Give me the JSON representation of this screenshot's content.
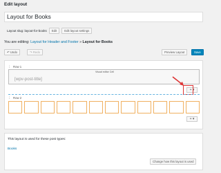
{
  "page": {
    "title": "Edit layout"
  },
  "layout": {
    "name": "Layout for Books",
    "slug_label": "Layout slug:",
    "slug": "layout-for-books",
    "edit_label": "Edit",
    "settings_label": "Edit layout settings"
  },
  "editing": {
    "prefix": "You are editing:",
    "parent": "Layout for Header and Footer",
    "separator": "»",
    "current": "Layout for Books"
  },
  "toolbar": {
    "undo_label": "↶ Undo",
    "redo_label": "↷ Redo",
    "preview_label": "Preview Layout",
    "save_label": "Save"
  },
  "rows": [
    {
      "label": "Row 1",
      "cell_caption": "Visual editor Cell",
      "cell_content": "[wpv-post-title]",
      "add_label": "+ ▾"
    },
    {
      "label": "Row 2",
      "columns": 12,
      "add_label": "+ ▾"
    }
  ],
  "footer": {
    "text": "This layout is used for these post types:",
    "link": "Books",
    "button_label": "Change how this layout is used"
  },
  "colors": {
    "accent": "#0085ba",
    "highlight": "#dd3333",
    "column_border": "#f0b060"
  }
}
